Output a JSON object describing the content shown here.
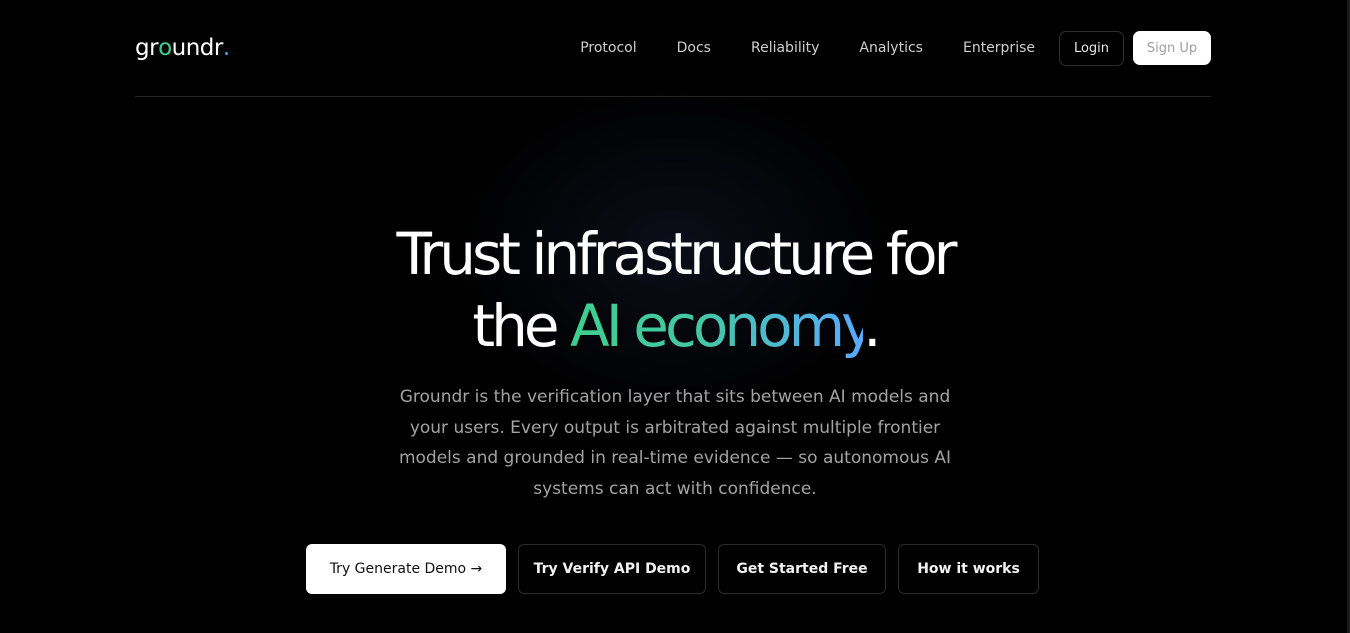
{
  "logo": {
    "text_start": "gr",
    "text_o": "o",
    "text_end": "undr",
    "text_dot": "."
  },
  "nav": {
    "links": [
      "Protocol",
      "Docs",
      "Reliability",
      "Analytics",
      "Enterprise"
    ],
    "login": "Login",
    "signup": "Sign Up"
  },
  "hero": {
    "headline_line1": "Trust infrastructure for",
    "headline_line2_start": "the ",
    "headline_line2_highlight": "AI economy",
    "headline_line2_end": ".",
    "subtext": "Groundr is the verification layer that sits between AI models and your users. Every output is arbitrated against multiple frontier models and grounded in real-time evidence — so autonomous AI systems can act with confidence."
  },
  "cta": {
    "primary": "Try Generate Demo →",
    "verify": "Try Verify API Demo",
    "start": "Get Started Free",
    "how": "How it works"
  },
  "colors": {
    "accent_green": "#3ecf8e",
    "accent_blue": "#5aa9ff",
    "background": "#000000"
  }
}
